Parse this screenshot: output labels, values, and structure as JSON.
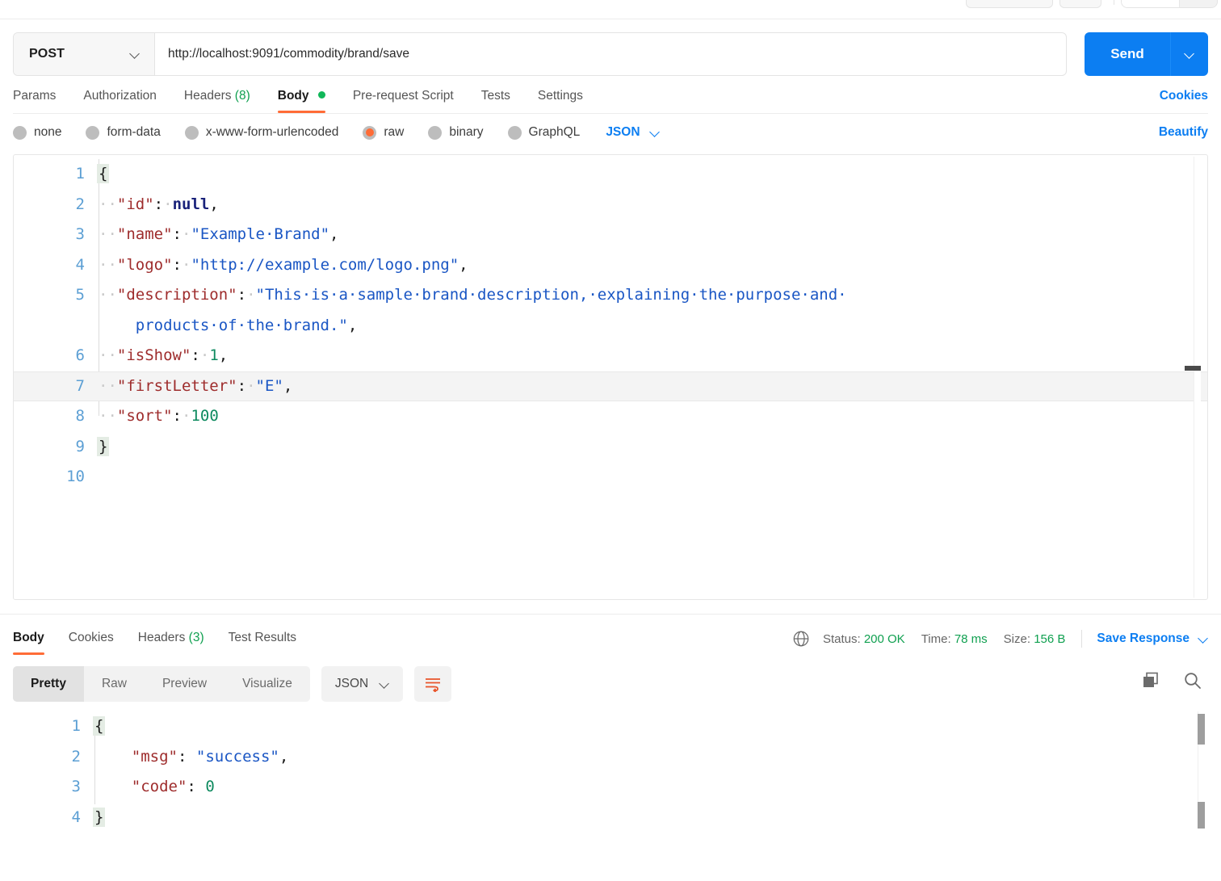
{
  "request": {
    "method": "POST",
    "url": "http://localhost:9091/commodity/brand/save",
    "send_label": "Send",
    "tabs": [
      {
        "label": "Params",
        "active": false
      },
      {
        "label": "Authorization",
        "active": false
      },
      {
        "label": "Headers",
        "count": "(8)",
        "active": false
      },
      {
        "label": "Body",
        "active": true,
        "dot": true
      },
      {
        "label": "Pre-request Script",
        "active": false
      },
      {
        "label": "Tests",
        "active": false
      },
      {
        "label": "Settings",
        "active": false
      }
    ],
    "cookies_link": "Cookies",
    "body_types": [
      {
        "label": "none",
        "selected": false
      },
      {
        "label": "form-data",
        "selected": false
      },
      {
        "label": "x-www-form-urlencoded",
        "selected": false
      },
      {
        "label": "raw",
        "selected": true
      },
      {
        "label": "binary",
        "selected": false
      },
      {
        "label": "GraphQL",
        "selected": false
      }
    ],
    "raw_format": "JSON",
    "beautify_label": "Beautify",
    "editor": {
      "line_numbers": [
        "1",
        "2",
        "3",
        "4",
        "5",
        "6",
        "7",
        "8",
        "9",
        "10"
      ],
      "lines": [
        {
          "n": "1",
          "text": "{"
        },
        {
          "n": "2",
          "text": "  \"id\": null,"
        },
        {
          "n": "3",
          "text": "  \"name\": \"Example Brand\","
        },
        {
          "n": "4",
          "text": "  \"logo\": \"http://example.com/logo.png\","
        },
        {
          "n": "5",
          "text": "  \"description\": \"This is a sample brand description, explaining the purpose and products of the brand.\","
        },
        {
          "n": "6",
          "text": "  \"isShow\": 1,"
        },
        {
          "n": "7",
          "text": "  \"firstLetter\": \"E\",",
          "active": true
        },
        {
          "n": "8",
          "text": "  \"sort\": 100"
        },
        {
          "n": "9",
          "text": "}"
        },
        {
          "n": "10",
          "text": ""
        }
      ],
      "tokens": {
        "id_key": "\"id\"",
        "id_val": "null",
        "name_key": "\"name\"",
        "name_val": "\"Example·Brand\"",
        "logo_key": "\"logo\"",
        "logo_val": "\"http://example.com/logo.png\"",
        "desc_key": "\"description\"",
        "desc_val_1": "\"This·is·a·sample·brand·description,·explaining·the·purpose·and·",
        "desc_val_2": "products·of·the·brand.\"",
        "isshow_key": "\"isShow\"",
        "isshow_val": "1",
        "first_key": "\"firstLetter\"",
        "first_val": "\"E\"",
        "sort_key": "\"sort\"",
        "sort_val": "100"
      }
    }
  },
  "response": {
    "tabs": [
      {
        "label": "Body",
        "active": true
      },
      {
        "label": "Cookies",
        "active": false
      },
      {
        "label": "Headers",
        "count": "(3)",
        "active": false
      },
      {
        "label": "Test Results",
        "active": false
      }
    ],
    "status_label": "Status:",
    "status_value": "200 OK",
    "time_label": "Time:",
    "time_value": "78 ms",
    "size_label": "Size:",
    "size_value": "156 B",
    "save_response": "Save Response",
    "view_modes": [
      {
        "label": "Pretty",
        "active": true
      },
      {
        "label": "Raw",
        "active": false
      },
      {
        "label": "Preview",
        "active": false
      },
      {
        "label": "Visualize",
        "active": false
      }
    ],
    "format": "JSON",
    "body": {
      "lines": [
        {
          "n": "1",
          "text": "{"
        },
        {
          "n": "2",
          "text": "    \"msg\": \"success\","
        },
        {
          "n": "3",
          "text": "    \"code\": 0"
        },
        {
          "n": "4",
          "text": "}"
        }
      ],
      "tokens": {
        "msg_key": "\"msg\"",
        "msg_val": "\"success\"",
        "code_key": "\"code\"",
        "code_val": "0"
      }
    }
  },
  "colors": {
    "accent_orange": "#ff6c37",
    "link_blue": "#0c7ef2",
    "status_green": "#10a050",
    "send_blue": "#0c7ef2"
  }
}
